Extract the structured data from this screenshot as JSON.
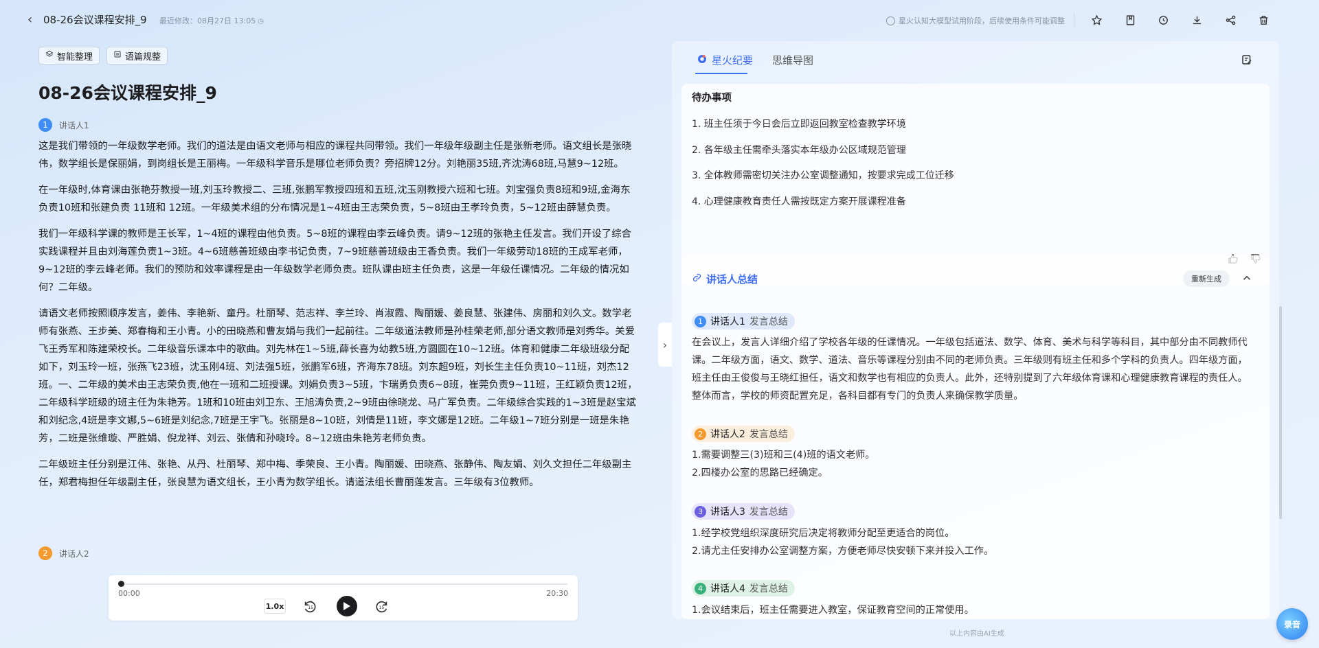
{
  "header": {
    "title": "08-26会议课程安排_9",
    "modified": "最近修改：08月27日 13:05",
    "notice": "星火认知大模型试用阶段，后续使用条件可能调整"
  },
  "toolbar": {
    "smart_organize": "智能整理",
    "text_normalize": "语篇规整"
  },
  "doc": {
    "title": "08-26会议课程安排_9",
    "speaker1": {
      "num": "1",
      "label": "讲话人1",
      "color": "#3f8cf5"
    },
    "speaker2": {
      "num": "2",
      "label": "讲话人2",
      "color": "#f59a2e"
    },
    "paragraphs": [
      "这是我们带领的一年级数学老师。我们的道法是由语文老师与相应的课程共同带领。我们一年级年级副主任是张新老师。语文组长是张晓伟，数学组长是保丽娟，到岗组长是王丽梅。一年级科学音乐是哪位老师负责？旁招牌12分。刘艳丽35班,齐沈涛68班,马慧9~12班。",
      "在一年级时,体育课由张艳芬教授一班,刘玉玲教授二、三班,张鹏军教授四班和五班,沈玉刚教授六班和七班。刘宝强负责8班和9班,金海东负责10班和张建负责 11班和 12班。一年级美术组的分布情况是1~4班由王志荣负责，5~8班由王孝玲负责，5~12班由薛慧负责。",
      "我们一年级科学课的教师是王长军，1~4班的课程由他负责。5~8班的课程由李云峰负责。请9~12班的张艳主任发言。我们开设了综合实践课程并且由刘海莲负责1~3班。4~6班慈善班级由李书记负责，7~9班慈善班级由王香负责。我们一年级劳动18班的王成军老师，9~12班的李云峰老师。我们的预防和效率课程是由一年级数学老师负责。班队课由班主任负责，这是一年级任课情况。二年级的情况如何？二年级。",
      "请语文老师按照顺序发言，姜伟、李艳新、童丹。杜丽琴、范志祥、李兰玲、肖淑霞、陶丽媛、姜良慧、张建伟、房丽和刘久文。数学老师有张燕、王步美、郑春梅和王小青。小的田晓燕和曹友娟与我们一起前往。二年级道法教师是孙桂荣老师,部分语文教师是刘秀华。关爱飞王秀军和陈建荣校长。二年级音乐课本中的歌曲。刘先林在1~5班,薛长喜为幼教5班,方圆圆在10~12班。体育和健康二年级班级分配如下，刘玉玲一班，张燕飞23班，沈玉刚4班、刘法强5班，张鹏军6班，齐海东78班。刘东超9班，刘长生主任负责10~11班，刘杰12班。一、二年级的美术由王志荣负责,他在一班和二班授课。刘娟负责3~5班，卞瑞勇负责6~8班，崔莞负责9~11班，王红颖负责12班，二年级科学班级的班主任为朱艳芳。1班和10班由刘卫东、王旭涛负责,2~9班由徐晓龙、马广军负责。二年级综合实践的1~3班是赵宝斌和刘纪念,4班是李文娜,5~6班是刘纪念,7班是王宇飞。张丽是8~10班，刘倩是11班，李文娜是12班。二年级1~7班分别是一班是朱艳芳，二班是张维璇、严胜娟、倪龙祥、刘云、张倩和孙晓玲。8~12班由朱艳芳老师负责。",
      "二年级班主任分别是江伟、张艳、从丹、杜丽琴、郑中梅、季荣良、王小青。陶丽媛、田晓燕、张静伟、陶友娟、刘久文担任二年级副主任，郑君梅担任年级副主任，张良慧为语文组长，王小青为数学组长。请道法组长曹丽莲发言。三年级有3位教师。"
    ]
  },
  "player": {
    "current": "00:00",
    "total": "20:30",
    "speed": "1.0x",
    "progress": 0.0
  },
  "right": {
    "tab_summary": "星火纪要",
    "tab_mindmap": "思维导图",
    "todo": {
      "title": "待办事项",
      "items": [
        "1. 班主任须于今日会后立即返回教室检查教学环境",
        "2. 各年级主任需牵头落实本年级办公区域规范管理",
        "3. 全体教师需密切关注办公室调整通知，按要求完成工位迁移",
        "4. 心理健康教育责任人需按既定方案开展课程准备"
      ]
    },
    "summary": {
      "title": "讲话人总结",
      "regen": "重新生成",
      "speakers": [
        {
          "num": "1",
          "name": "讲话人1",
          "label": "发言总结",
          "color": "#3f8cf5",
          "bg": "#dfe9fb",
          "text": "在会议上，发言人详细介绍了学校各年级的任课情况。一年级包括道法、数学、体育、美术与科学等科目，其中部分由不同教师代课。二年级方面，语文、数学、道法、音乐等课程分别由不同的老师负责。三年级则有班主任和多个学科的负责人。四年级方面，班主任由王俊俊与王晓红担任，语文和数学也有相应的负责人。此外，还特别提到了六年级体育课和心理健康教育课程的责任人。整体而言，学校的师资配置充足，各科目都有专门的负责人来确保教学质量。"
        },
        {
          "num": "2",
          "name": "讲话人2",
          "label": "发言总结",
          "color": "#f59a2e",
          "bg": "#fbeedd",
          "text": "1.需要调整三(3)班和三(4)班的语文老师。\n2.四楼办公室的思路已经确定。"
        },
        {
          "num": "3",
          "name": "讲话人3",
          "label": "发言总结",
          "color": "#6a5fe0",
          "bg": "#e6e3fa",
          "text": "1.经学校党组织深度研究后决定将教师分配至更适合的岗位。\n2.请尤主任安排办公室调整方案，方便老师尽快安顿下来并投入工作。"
        },
        {
          "num": "4",
          "name": "讲话人4",
          "label": "发言总结",
          "color": "#38b27a",
          "bg": "#dff2e8",
          "text": "1.会议结束后，班主任需要进入教室，保证教育空间的正常使用。"
        }
      ]
    },
    "ai_note": "以上内容由AI生成",
    "float_label": "录音"
  }
}
